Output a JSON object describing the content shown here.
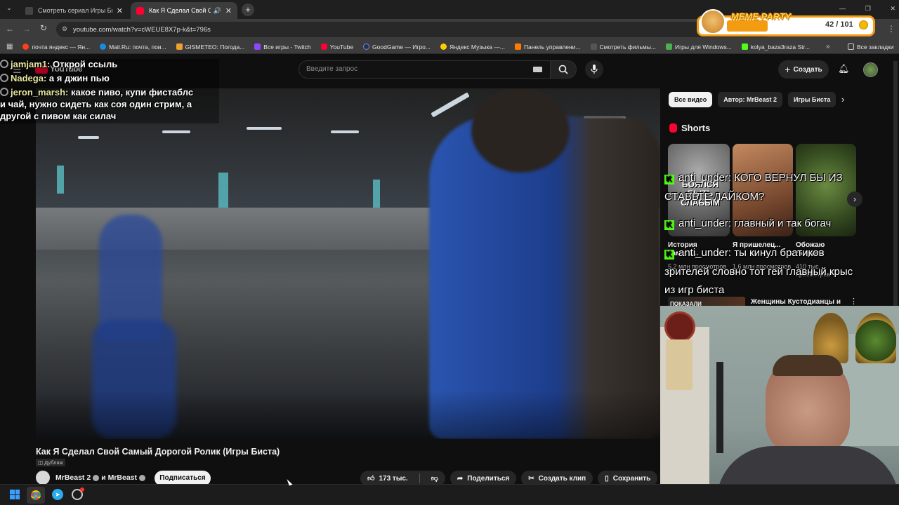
{
  "browser": {
    "tabs": [
      {
        "title": "Смотреть сериал Игры Биста ...",
        "active": false
      },
      {
        "title": "Как Я Сделал Свой Самый",
        "active": true
      }
    ],
    "url": "youtube.com/watch?v=cWEUE8X7p-k&t=796s",
    "bookmarks": [
      "почта яндекс — Ян...",
      "Mail.Ru: почта, пои...",
      "GISMETEO: Погода...",
      "Все игры - Twitch",
      "YouTube",
      "GoodGame — Игро...",
      "Яндекс Музыка —...",
      "Панель управлени...",
      "Смотреть фильмы...",
      "Игры для Windows...",
      "kolya_baza3raza Str..."
    ],
    "all_bookmarks": "Все закладки"
  },
  "meme_party": {
    "label": "MEME PARTY",
    "count": "42 / 101"
  },
  "youtube": {
    "logo": "YouTube",
    "search_placeholder": "Введите запрос",
    "create_label": "Создать",
    "chips": [
      "Все видео",
      "Автор: MrBeast 2",
      "Игры Биста"
    ],
    "shorts_title": "Shorts",
    "shorts": [
      {
        "title": "История самого...",
        "views": "5,2 млн просмотров",
        "overlay_text": "БОЯЛСЯ БЫТЬ СЛАБЫМ"
      },
      {
        "title": "Я пришелец...",
        "views": "1,6 млн просмотров"
      },
      {
        "title": "Обожаю лягушек",
        "views": "410 тыс. просмотров"
      }
    ],
    "next_video": {
      "thumb_label": "ПОКАЗАЛИ",
      "title": "Женщины Кустодианцы и"
    },
    "video_title": "Как Я Сделал Свой Самый Дорогой Ролик (Игры Биста)",
    "dub_badge": "Дубляж",
    "channel": "MrBeast 2",
    "channel_join": "и MrBeast",
    "subscribe": "Подписаться",
    "likes": "173 тыс.",
    "share": "Поделиться",
    "clip": "Создать клип",
    "save": "Сохранить"
  },
  "stream_chat": [
    {
      "nick": "jamjam1:",
      "text": " Открой ссыль"
    },
    {
      "nick": "Nadega:",
      "text": " а я джин пью"
    },
    {
      "nick": "jeron_marsh:",
      "text": " какое пиво, купи фистаблс"
    }
  ],
  "stream_chat_cont": [
    "и чай, нужно сидеть как соя один стрим, а",
    "другой с пивом как силач"
  ],
  "kick_overlay": [
    "anti_under: КОГО ВЕРНУЛ БЫ ИЗ",
    "СТАВЬТЕ ЛАЙКОМ?",
    "anti_under: главный и так богач",
    "anti_under: ты кинул братиков",
    "зрителей словно тот гей главный крыс",
    "из игр биста"
  ]
}
